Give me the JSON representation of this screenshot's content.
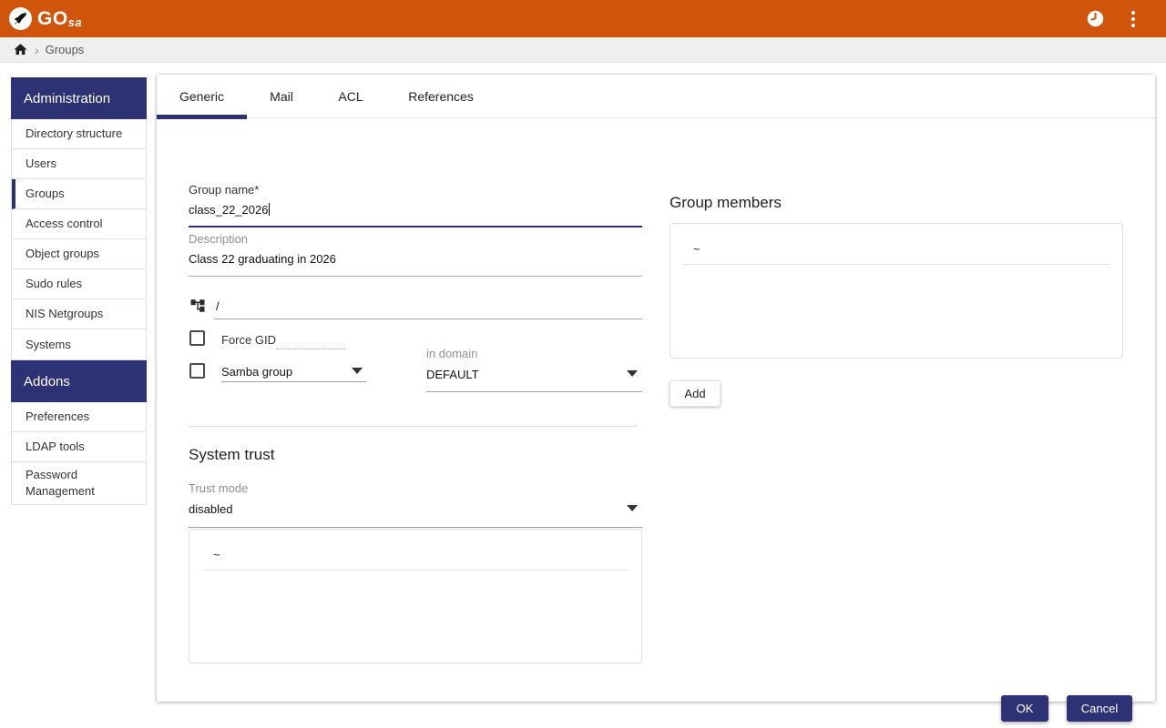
{
  "header": {
    "logo_primary": "GO",
    "logo_secondary": "sa",
    "icons": {
      "clock": "clock-icon",
      "menu": "kebab-menu-icon"
    }
  },
  "breadcrumb": {
    "current": "Groups"
  },
  "sidebar": {
    "sections": [
      {
        "title": "Administration",
        "items": [
          {
            "label": "Directory structure"
          },
          {
            "label": "Users"
          },
          {
            "label": "Groups",
            "active": true
          },
          {
            "label": "Access control"
          },
          {
            "label": "Object groups"
          },
          {
            "label": "Sudo rules"
          },
          {
            "label": "NIS Netgroups"
          },
          {
            "label": "Systems"
          }
        ]
      },
      {
        "title": "Addons",
        "items": [
          {
            "label": "Preferences"
          },
          {
            "label": "LDAP tools"
          },
          {
            "label": "Password Management"
          }
        ]
      }
    ]
  },
  "tabs": [
    {
      "label": "Generic",
      "active": true
    },
    {
      "label": "Mail",
      "active": false
    },
    {
      "label": "ACL",
      "active": false
    },
    {
      "label": "References",
      "active": false
    }
  ],
  "form": {
    "group_name": {
      "label": "Group name*",
      "value": "class_22_2026"
    },
    "description": {
      "label": "Description",
      "value": "Class 22 graduating in 2026"
    },
    "base": {
      "value": "/"
    },
    "force_gid": {
      "label": "Force GID",
      "checked": false
    },
    "samba_group": {
      "label": "Samba group",
      "checked": false
    },
    "in_domain": {
      "label": "in domain",
      "value": "DEFAULT"
    },
    "system_trust": {
      "heading": "System trust",
      "trust_mode_label": "Trust mode",
      "trust_mode_value": "disabled",
      "list": [
        "~"
      ]
    }
  },
  "members": {
    "heading": "Group members",
    "list": [
      "~"
    ],
    "add_button": "Add"
  },
  "actions": {
    "ok": "OK",
    "cancel": "Cancel"
  },
  "colors": {
    "topbar_orange": "#D0540A",
    "accent_navy": "#2C3274"
  }
}
